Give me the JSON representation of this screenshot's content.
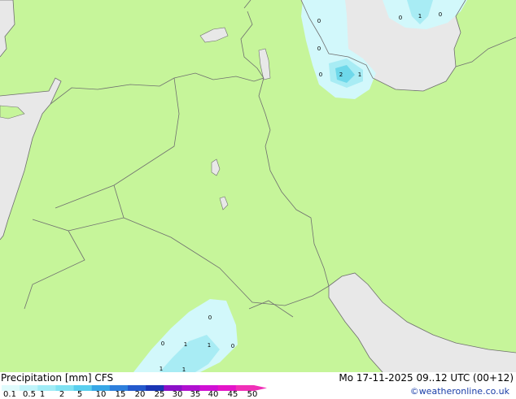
{
  "map": {
    "colors": {
      "land": "#c6f59a",
      "sea": "#e8e8e8",
      "border": "#6f6f6f",
      "precip_light": "#d2f8fb",
      "precip_mid": "#a8ecf4",
      "precip_strong": "#6ed8ea"
    },
    "point_values": {
      "north": [
        "0",
        "0",
        "0",
        "2",
        "1"
      ],
      "northeast": [
        "0",
        "1",
        "0"
      ],
      "south": [
        "0",
        "0",
        "1",
        "1",
        "0",
        "1",
        "1"
      ]
    }
  },
  "footer": {
    "title_left": "Precipitation [mm] CFS",
    "title_right": "Mo 17-11-2025 09..12 UTC (00+12)",
    "credit": "©weatheronline.co.uk"
  },
  "legend": {
    "ticks": [
      "0.1",
      "0.5",
      "1",
      "2",
      "5",
      "10",
      "15",
      "20",
      "25",
      "30",
      "35",
      "40",
      "45",
      "50"
    ],
    "colors": [
      "#e0fbfc",
      "#c0f4fa",
      "#a0ecf6",
      "#80e2f2",
      "#5acfee",
      "#38a7e6",
      "#2e7fdc",
      "#2459cc",
      "#1a35b4",
      "#8c10c8",
      "#b010d0",
      "#d010d4",
      "#e414c8",
      "#f030b8"
    ]
  }
}
